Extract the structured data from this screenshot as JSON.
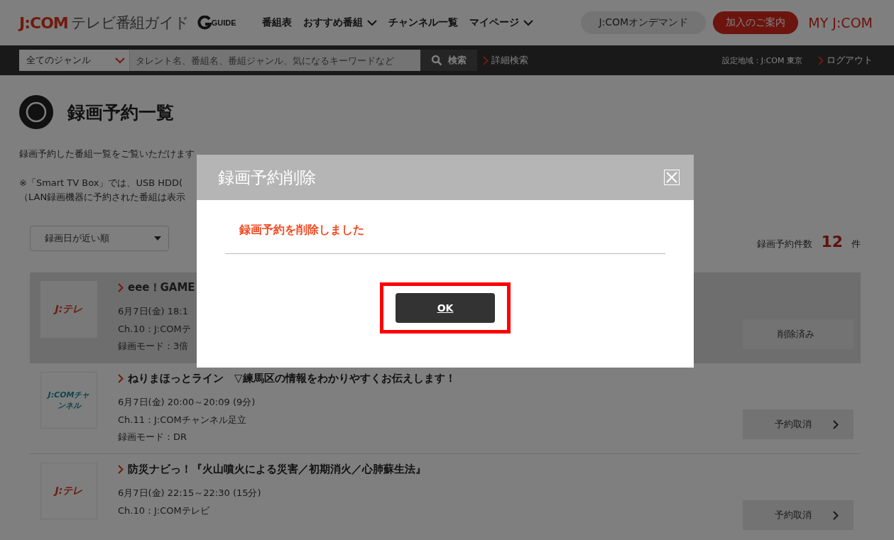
{
  "header": {
    "logo": {
      "brand": "J:COM",
      "product": "テレビ番組ガイド",
      "badge": "GUIDE"
    },
    "nav": [
      {
        "label": "番組表",
        "dropdown": false
      },
      {
        "label": "おすすめ番組",
        "dropdown": true
      },
      {
        "label": "チャンネル一覧",
        "dropdown": false
      },
      {
        "label": "マイページ",
        "dropdown": true
      }
    ],
    "buttons": [
      {
        "label": "J:COMオンデマンド",
        "kind": "grey"
      },
      {
        "label": "加入のご案内",
        "kind": "red"
      },
      {
        "label": "MY J:COM",
        "kind": "text"
      }
    ]
  },
  "search_bar": {
    "genre": "全てのジャンル",
    "placeholder": "タレント名、番組名、番組ジャンル、気になるキーワードなど",
    "search_button": "検索",
    "advanced_link": "詳細検索",
    "region": "設定地域：J:COM 東京",
    "logout": "ログアウト"
  },
  "page": {
    "title": "録画予約一覧",
    "intro": "録画予約した番組一覧をご覧いただけます",
    "notes": [
      "※「Smart TV Box」では、USB HDD(",
      "（LAN録画機器に予約された番組は表示"
    ],
    "sort": "録画日が近い順",
    "count_label": "録画予約件数",
    "count": "12",
    "count_unit": "件"
  },
  "items": [
    {
      "logo": {
        "text": "J:テレ",
        "kind": "tele"
      },
      "title": "eee！GAME",
      "datetime": "6月7日(金) 18:1",
      "channel": "Ch.10：J:COMテ",
      "mode": "録画モード：3倍",
      "button": "削除済み",
      "deleted": true
    },
    {
      "logo": {
        "text": "J:COMチャンネル",
        "kind": "channel"
      },
      "title": "ねりまほっとライン　▽練馬区の情報をわかりやすくお伝えします！",
      "datetime": "6月7日(金) 20:00～20:09 (9分)",
      "channel": "Ch.11：J:COMチャンネル足立",
      "mode": "録画モード：DR",
      "button": "予約取消",
      "deleted": false
    },
    {
      "logo": {
        "text": "J:テレ",
        "kind": "tele"
      },
      "title": "防災ナビっ！『火山噴火による災害／初期消火／心肺蘇生法』",
      "datetime": "6月7日(金) 22:15～22:30 (15分)",
      "channel": "Ch.10：J:COMテレビ",
      "button": "予約取消",
      "deleted": false
    }
  ],
  "dialog": {
    "title": "録画予約削除",
    "message": "録画予約を削除しました",
    "ok": "OK",
    "highlighted": true
  }
}
